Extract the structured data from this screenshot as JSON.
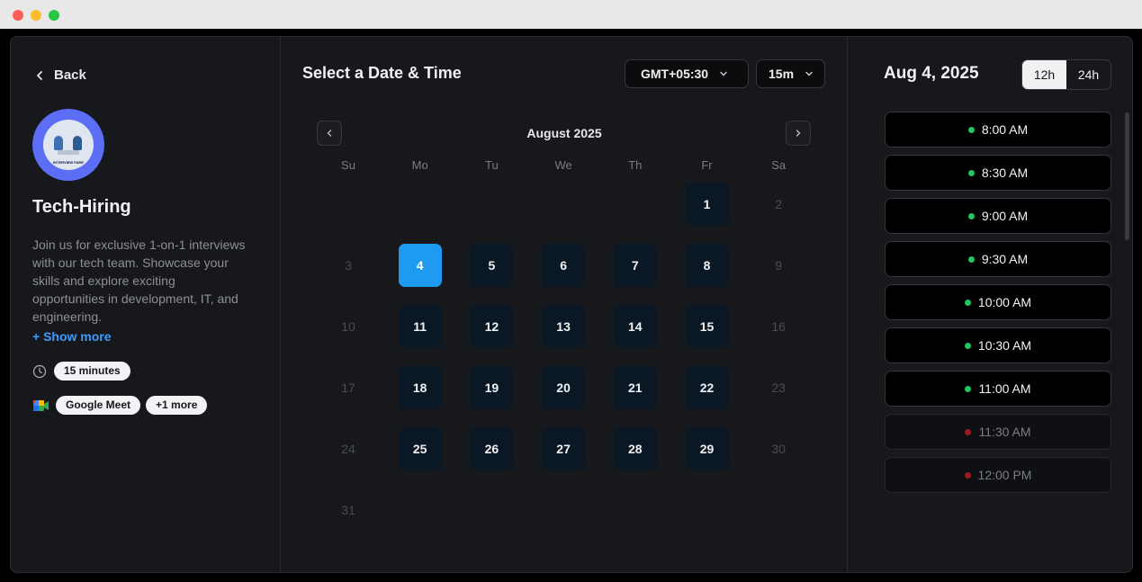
{
  "left": {
    "back_label": "Back",
    "avatar_caption": "INTERVIEW FARE",
    "title": "Tech-Hiring",
    "description": "Join us for exclusive 1-on-1 interviews with our tech team. Showcase your skills and explore exciting opportunities in development, IT, and engineering.",
    "show_more": "+ Show more",
    "duration": "15 minutes",
    "location": "Google Meet",
    "location_more": "+1 more"
  },
  "middle": {
    "title": "Select a Date & Time",
    "timezone": "GMT+05:30",
    "duration_select": "15m",
    "month_label": "August 2025",
    "weekdays": [
      "Su",
      "Mo",
      "Tu",
      "We",
      "Th",
      "Fr",
      "Sa"
    ],
    "days": [
      {
        "n": "1",
        "row": 0,
        "col": 5,
        "state": "avail"
      },
      {
        "n": "2",
        "row": 0,
        "col": 6,
        "state": "off"
      },
      {
        "n": "3",
        "row": 1,
        "col": 0,
        "state": "off"
      },
      {
        "n": "4",
        "row": 1,
        "col": 1,
        "state": "selected"
      },
      {
        "n": "5",
        "row": 1,
        "col": 2,
        "state": "avail"
      },
      {
        "n": "6",
        "row": 1,
        "col": 3,
        "state": "avail"
      },
      {
        "n": "7",
        "row": 1,
        "col": 4,
        "state": "avail"
      },
      {
        "n": "8",
        "row": 1,
        "col": 5,
        "state": "avail"
      },
      {
        "n": "9",
        "row": 1,
        "col": 6,
        "state": "off"
      },
      {
        "n": "10",
        "row": 2,
        "col": 0,
        "state": "off"
      },
      {
        "n": "11",
        "row": 2,
        "col": 1,
        "state": "avail"
      },
      {
        "n": "12",
        "row": 2,
        "col": 2,
        "state": "avail"
      },
      {
        "n": "13",
        "row": 2,
        "col": 3,
        "state": "avail"
      },
      {
        "n": "14",
        "row": 2,
        "col": 4,
        "state": "avail"
      },
      {
        "n": "15",
        "row": 2,
        "col": 5,
        "state": "avail"
      },
      {
        "n": "16",
        "row": 2,
        "col": 6,
        "state": "off"
      },
      {
        "n": "17",
        "row": 3,
        "col": 0,
        "state": "off"
      },
      {
        "n": "18",
        "row": 3,
        "col": 1,
        "state": "avail"
      },
      {
        "n": "19",
        "row": 3,
        "col": 2,
        "state": "avail"
      },
      {
        "n": "20",
        "row": 3,
        "col": 3,
        "state": "avail"
      },
      {
        "n": "21",
        "row": 3,
        "col": 4,
        "state": "avail"
      },
      {
        "n": "22",
        "row": 3,
        "col": 5,
        "state": "avail"
      },
      {
        "n": "23",
        "row": 3,
        "col": 6,
        "state": "off"
      },
      {
        "n": "24",
        "row": 4,
        "col": 0,
        "state": "off"
      },
      {
        "n": "25",
        "row": 4,
        "col": 1,
        "state": "avail"
      },
      {
        "n": "26",
        "row": 4,
        "col": 2,
        "state": "avail"
      },
      {
        "n": "27",
        "row": 4,
        "col": 3,
        "state": "avail"
      },
      {
        "n": "28",
        "row": 4,
        "col": 4,
        "state": "avail"
      },
      {
        "n": "29",
        "row": 4,
        "col": 5,
        "state": "avail"
      },
      {
        "n": "30",
        "row": 4,
        "col": 6,
        "state": "off"
      },
      {
        "n": "31",
        "row": 5,
        "col": 0,
        "state": "off"
      }
    ]
  },
  "right": {
    "date_label": "Aug 4, 2025",
    "format_12h": "12h",
    "format_24h": "24h",
    "slots": [
      {
        "time": "8:00 AM",
        "available": true
      },
      {
        "time": "8:30 AM",
        "available": true
      },
      {
        "time": "9:00 AM",
        "available": true
      },
      {
        "time": "9:30 AM",
        "available": true
      },
      {
        "time": "10:00 AM",
        "available": true
      },
      {
        "time": "10:30 AM",
        "available": true
      },
      {
        "time": "11:00 AM",
        "available": true
      },
      {
        "time": "11:30 AM",
        "available": false
      },
      {
        "time": "12:00 PM",
        "available": false
      }
    ]
  },
  "colors": {
    "accent": "#1e9bf0",
    "link": "#3b9cff",
    "available_dot": "#22c55e",
    "busy_dot": "#9b1c1c"
  }
}
